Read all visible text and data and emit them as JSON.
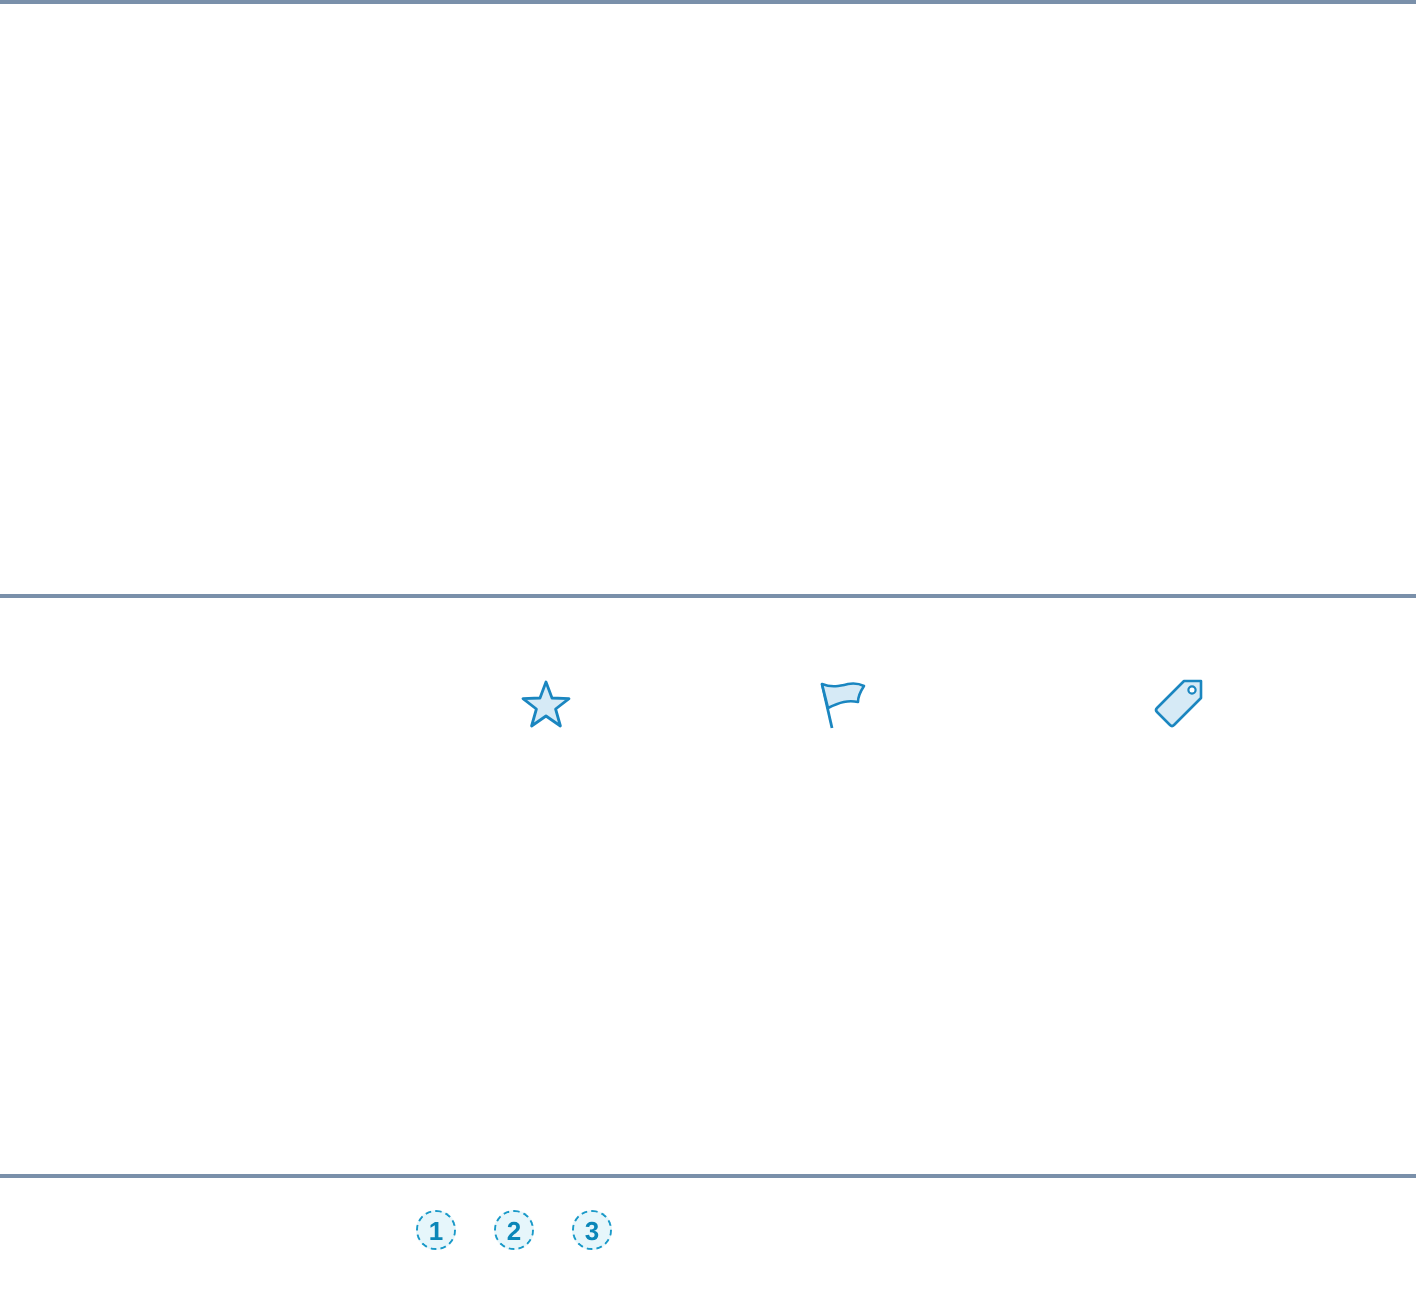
{
  "number_badges": [
    {
      "label": "1"
    },
    {
      "label": "2"
    },
    {
      "label": "3"
    }
  ]
}
